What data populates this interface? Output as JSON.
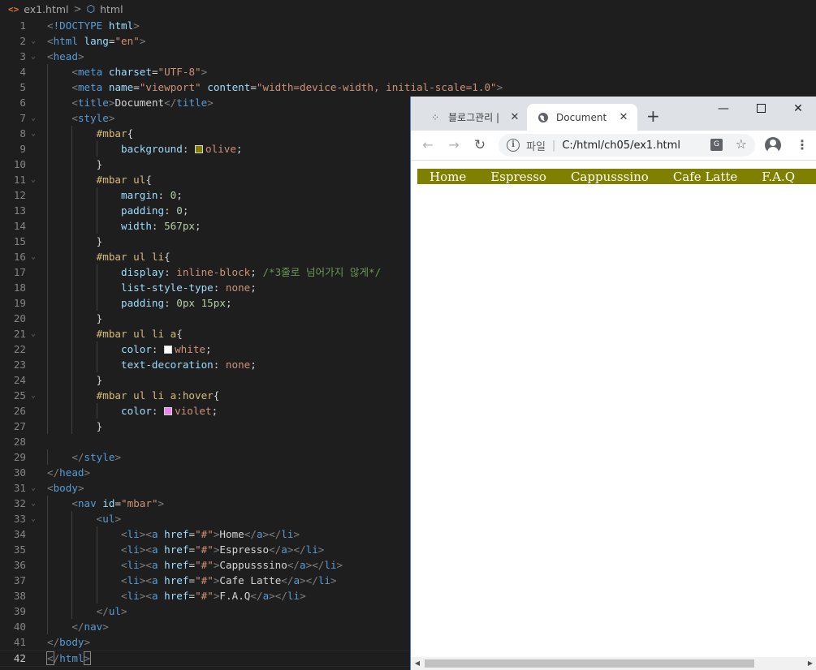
{
  "breadcrumb": {
    "file_icon": "<>",
    "file": "ex1.html",
    "separator": ">",
    "symbol": "html"
  },
  "editor": {
    "lines": [
      {
        "n": "1",
        "text": "<!DOCTYPE html>"
      },
      {
        "n": "2",
        "text": "<html lang=\"en\">"
      },
      {
        "n": "3",
        "text": "<head>"
      },
      {
        "n": "4",
        "text": "    <meta charset=\"UTF-8\">"
      },
      {
        "n": "5",
        "text": "    <meta name=\"viewport\" content=\"width=device-width, initial-scale=1.0\">"
      },
      {
        "n": "6",
        "text": "    <title>Document</title>"
      },
      {
        "n": "7",
        "text": "    <style>"
      },
      {
        "n": "8",
        "text": "        #mbar{"
      },
      {
        "n": "9",
        "text": "            background: olive;"
      },
      {
        "n": "10",
        "text": "        }"
      },
      {
        "n": "11",
        "text": "        #mbar ul{"
      },
      {
        "n": "12",
        "text": "            margin: 0;"
      },
      {
        "n": "13",
        "text": "            padding: 0;"
      },
      {
        "n": "14",
        "text": "            width: 567px;"
      },
      {
        "n": "15",
        "text": "        }"
      },
      {
        "n": "16",
        "text": "        #mbar ul li{"
      },
      {
        "n": "17",
        "text": "            display: inline-block; /*3줄로 넘어가지 않게*/"
      },
      {
        "n": "18",
        "text": "            list-style-type: none;"
      },
      {
        "n": "19",
        "text": "            padding: 0px 15px;"
      },
      {
        "n": "20",
        "text": "        }"
      },
      {
        "n": "21",
        "text": "        #mbar ul li a{"
      },
      {
        "n": "22",
        "text": "            color: white;"
      },
      {
        "n": "23",
        "text": "            text-decoration: none;"
      },
      {
        "n": "24",
        "text": "        }"
      },
      {
        "n": "25",
        "text": "        #mbar ul li a:hover{"
      },
      {
        "n": "26",
        "text": "            color: violet;"
      },
      {
        "n": "27",
        "text": "        }"
      },
      {
        "n": "28",
        "text": ""
      },
      {
        "n": "29",
        "text": "    </style>"
      },
      {
        "n": "30",
        "text": "</head>"
      },
      {
        "n": "31",
        "text": "<body>"
      },
      {
        "n": "32",
        "text": "    <nav id=\"mbar\">"
      },
      {
        "n": "33",
        "text": "        <ul>"
      },
      {
        "n": "34",
        "text": "            <li><a href=\"#\">Home</a></li>"
      },
      {
        "n": "35",
        "text": "            <li><a href=\"#\">Espresso</a></li>"
      },
      {
        "n": "36",
        "text": "            <li><a href=\"#\">Cappusssino</a></li>"
      },
      {
        "n": "37",
        "text": "            <li><a href=\"#\">Cafe Latte</a></li>"
      },
      {
        "n": "38",
        "text": "            <li><a href=\"#\">F.A.Q</a></li>"
      },
      {
        "n": "39",
        "text": "        </ul>"
      },
      {
        "n": "40",
        "text": "    </nav>"
      },
      {
        "n": "41",
        "text": "</body>"
      },
      {
        "n": "42",
        "text": "</html>"
      }
    ],
    "swatches": {
      "olive": "#808000",
      "white": "#ffffff",
      "violet": "#ee82ee"
    }
  },
  "browser": {
    "tabs": [
      {
        "label": "블로그관리 |",
        "icon": "blog-favicon",
        "close": "✕"
      },
      {
        "label": "Document",
        "icon": "globe-favicon",
        "close": "✕"
      }
    ],
    "new_tab": "+",
    "window": {
      "minimize": "—",
      "close": "✕"
    },
    "toolbar": {
      "back": "←",
      "forward": "→",
      "reload": "↻",
      "scheme": "파일",
      "url": "C:/html/ch05/ex1.html",
      "info": "i",
      "star": "☆",
      "menu": "⋮",
      "translate": "G"
    },
    "page": {
      "nav_color": "#808000",
      "nav_items": [
        "Home",
        "Espresso",
        "Cappusssino",
        "Cafe Latte",
        "F.A.Q"
      ]
    },
    "scroll": {
      "left": "◀",
      "right": "▶"
    }
  }
}
